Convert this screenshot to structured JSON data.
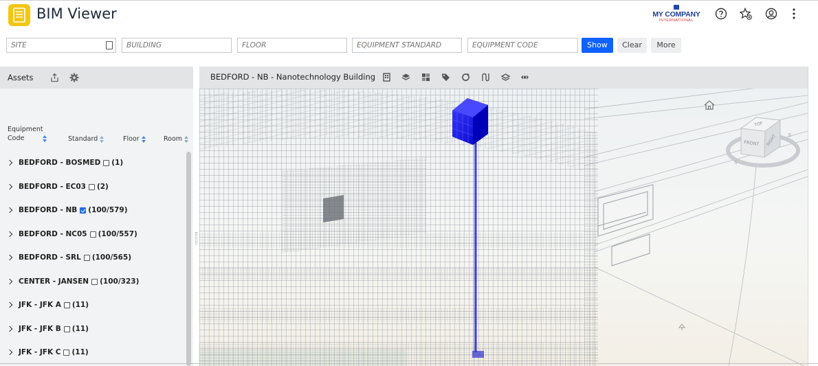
{
  "header": {
    "title": "BIM Viewer",
    "company_name": "MY COMPANY",
    "company_sub": "INTERNATIONAL",
    "icons": [
      "help-icon",
      "favorites-icon",
      "user-icon",
      "more-icon"
    ]
  },
  "filters": {
    "site_placeholder": "SITE",
    "building_placeholder": "BUILDING",
    "floor_placeholder": "FLOOR",
    "standard_placeholder": "EQUIPMENT STANDARD",
    "code_placeholder": "EQUIPMENT CODE",
    "show_label": "Show",
    "clear_label": "Clear",
    "more_label": "More"
  },
  "assets": {
    "title": "Assets",
    "columns": {
      "code_line1": "Equipment",
      "code_line2": "Code",
      "standard": "Standard",
      "floor": "Floor",
      "room": "Room"
    },
    "rows": [
      {
        "label": "BEDFORD - BOSMED",
        "checked": false,
        "count": "(1)"
      },
      {
        "label": "BEDFORD - EC03",
        "checked": false,
        "count": "(2)"
      },
      {
        "label": "BEDFORD - NB",
        "checked": true,
        "count": "(100/579)"
      },
      {
        "label": "BEDFORD - NC05",
        "checked": false,
        "count": "(100/557)"
      },
      {
        "label": "BEDFORD - SRL",
        "checked": false,
        "count": "(100/565)"
      },
      {
        "label": "CENTER - JANSEN",
        "checked": false,
        "count": "(100/323)"
      },
      {
        "label": "JFK - JFK A",
        "checked": false,
        "count": "(11)"
      },
      {
        "label": "JFK - JFK B",
        "checked": false,
        "count": "(11)"
      },
      {
        "label": "JFK - JFK C",
        "checked": false,
        "count": "(11)"
      }
    ]
  },
  "viewer": {
    "title": "BEDFORD - NB - Nanotechnology Building",
    "toolbar_icons": [
      "building-icon",
      "layers-icon",
      "grid-icon",
      "tag-icon",
      "rotate-icon",
      "path-icon",
      "model-icon",
      "explode-icon"
    ],
    "navcube": {
      "top": "TOP",
      "front": "FRONT",
      "right": "RIGHT"
    },
    "highlight_color": "#1414e6"
  }
}
